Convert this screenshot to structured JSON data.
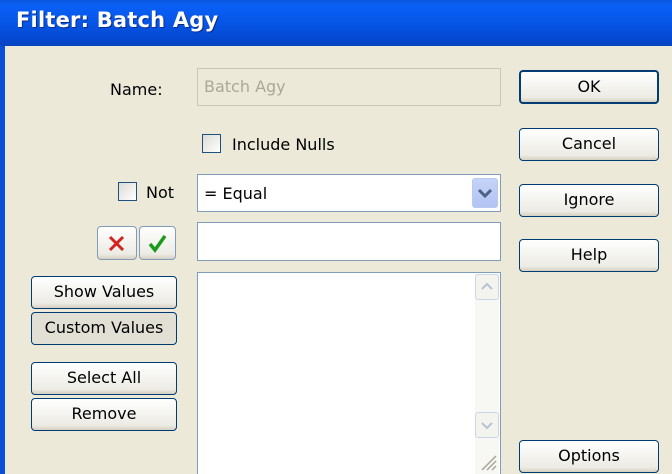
{
  "window": {
    "title": "Filter: Batch Agy"
  },
  "form": {
    "name_label": "Name:",
    "name_value": "Batch Agy",
    "include_nulls_label": "Include Nulls",
    "include_nulls_checked": false,
    "not_label": "Not",
    "not_checked": false,
    "operator_selected": "= Equal",
    "value_input": ""
  },
  "buttons": {
    "ok": "OK",
    "cancel": "Cancel",
    "ignore": "Ignore",
    "help": "Help",
    "options": "Options",
    "show_values": "Show Values",
    "custom_values": "Custom Values",
    "select_all": "Select All",
    "remove": "Remove"
  },
  "colors": {
    "titlebar": "#0a5ff5",
    "background": "#ece9d8",
    "reject": "#d32020",
    "accept": "#1a9a1a"
  },
  "icons": [
    "reject-x-icon",
    "accept-check-icon",
    "chevron-down-icon",
    "scroll-up-arrow-icon",
    "scroll-down-arrow-icon",
    "resize-grip-icon"
  ]
}
